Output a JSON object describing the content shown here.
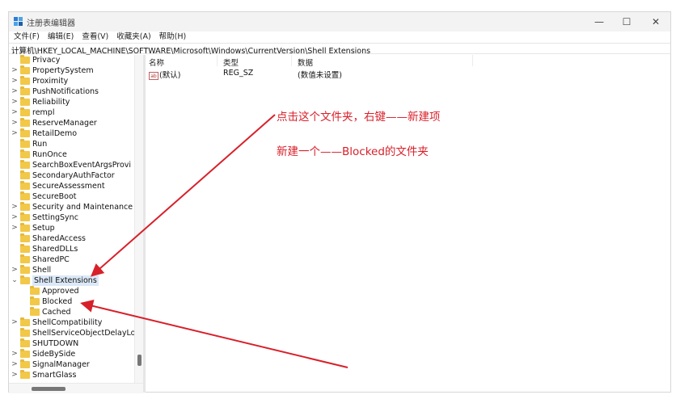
{
  "window": {
    "title": "注册表编辑器",
    "min": "—",
    "max": "☐",
    "close": "✕"
  },
  "menu": [
    "文件(F)",
    "编辑(E)",
    "查看(V)",
    "收藏夹(A)",
    "帮助(H)"
  ],
  "address": "计算机\\HKEY_LOCAL_MACHINE\\SOFTWARE\\Microsoft\\Windows\\CurrentVersion\\Shell Extensions",
  "tree": [
    {
      "label": "Privacy",
      "level": 0,
      "expander": ""
    },
    {
      "label": "PropertySystem",
      "level": 0,
      "expander": ">"
    },
    {
      "label": "Proximity",
      "level": 0,
      "expander": ">"
    },
    {
      "label": "PushNotifications",
      "level": 0,
      "expander": ">"
    },
    {
      "label": "Reliability",
      "level": 0,
      "expander": ">"
    },
    {
      "label": "rempl",
      "level": 0,
      "expander": ">"
    },
    {
      "label": "ReserveManager",
      "level": 0,
      "expander": ">"
    },
    {
      "label": "RetailDemo",
      "level": 0,
      "expander": ">"
    },
    {
      "label": "Run",
      "level": 0,
      "expander": ""
    },
    {
      "label": "RunOnce",
      "level": 0,
      "expander": ""
    },
    {
      "label": "SearchBoxEventArgsProvi",
      "level": 0,
      "expander": ""
    },
    {
      "label": "SecondaryAuthFactor",
      "level": 0,
      "expander": ""
    },
    {
      "label": "SecureAssessment",
      "level": 0,
      "expander": ""
    },
    {
      "label": "SecureBoot",
      "level": 0,
      "expander": ""
    },
    {
      "label": "Security and Maintenance",
      "level": 0,
      "expander": ">"
    },
    {
      "label": "SettingSync",
      "level": 0,
      "expander": ">"
    },
    {
      "label": "Setup",
      "level": 0,
      "expander": ">"
    },
    {
      "label": "SharedAccess",
      "level": 0,
      "expander": ""
    },
    {
      "label": "SharedDLLs",
      "level": 0,
      "expander": ""
    },
    {
      "label": "SharedPC",
      "level": 0,
      "expander": ""
    },
    {
      "label": "Shell",
      "level": 0,
      "expander": ">"
    },
    {
      "label": "Shell Extensions",
      "level": 0,
      "expander": "⌄",
      "selected": true
    },
    {
      "label": "Approved",
      "level": 1,
      "expander": ""
    },
    {
      "label": "Blocked",
      "level": 1,
      "expander": ""
    },
    {
      "label": "Cached",
      "level": 1,
      "expander": ""
    },
    {
      "label": "ShellCompatibility",
      "level": 0,
      "expander": ">"
    },
    {
      "label": "ShellServiceObjectDelayLo",
      "level": 0,
      "expander": ""
    },
    {
      "label": "SHUTDOWN",
      "level": 0,
      "expander": ""
    },
    {
      "label": "SideBySide",
      "level": 0,
      "expander": ">"
    },
    {
      "label": "SignalManager",
      "level": 0,
      "expander": ">"
    },
    {
      "label": "SmartGlass",
      "level": 0,
      "expander": ">"
    }
  ],
  "list": {
    "headers": {
      "name": "名称",
      "type": "类型",
      "data": "数据"
    },
    "rows": [
      {
        "icon": "ab",
        "name": "(默认)",
        "type": "REG_SZ",
        "data": "(数值未设置)"
      }
    ]
  },
  "annotations": {
    "line1": "点击这个文件夹，右键——新建项",
    "line2": "新建一个——Blocked的文件夹",
    "color": "#d8202a"
  }
}
